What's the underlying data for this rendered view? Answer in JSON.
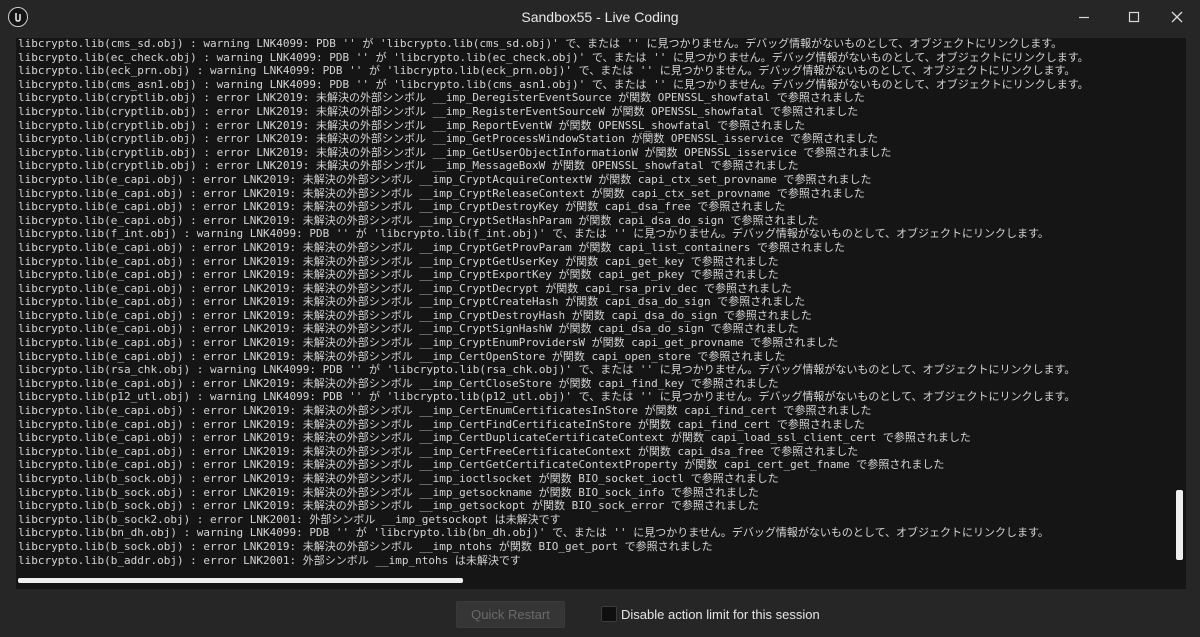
{
  "window": {
    "title": "Sandbox55 - Live Coding",
    "icon": "unreal-engine-logo",
    "controls": [
      "minimize-icon",
      "maximize-icon",
      "close-icon"
    ]
  },
  "log": {
    "lines": [
      "libcrypto.lib(cms_sd.obj) : warning LNK4099: PDB '' が 'libcrypto.lib(cms_sd.obj)' で、または '' に見つかりません。デバッグ情報がないものとして、オブジェクトにリンクします。",
      "libcrypto.lib(ec_check.obj) : warning LNK4099: PDB '' が 'libcrypto.lib(ec_check.obj)' で、または '' に見つかりません。デバッグ情報がないものとして、オブジェクトにリンクします。",
      "libcrypto.lib(eck_prn.obj) : warning LNK4099: PDB '' が 'libcrypto.lib(eck_prn.obj)' で、または '' に見つかりません。デバッグ情報がないものとして、オブジェクトにリンクします。",
      "libcrypto.lib(cms_asn1.obj) : warning LNK4099: PDB '' が 'libcrypto.lib(cms_asn1.obj)' で、または '' に見つかりません。デバッグ情報がないものとして、オブジェクトにリンクします。",
      "libcrypto.lib(cryptlib.obj) : error LNK2019: 未解決の外部シンボル __imp_DeregisterEventSource が関数 OPENSSL_showfatal で参照されました",
      "libcrypto.lib(cryptlib.obj) : error LNK2019: 未解決の外部シンボル __imp_RegisterEventSourceW が関数 OPENSSL_showfatal で参照されました",
      "libcrypto.lib(cryptlib.obj) : error LNK2019: 未解決の外部シンボル __imp_ReportEventW が関数 OPENSSL_showfatal で参照されました",
      "libcrypto.lib(cryptlib.obj) : error LNK2019: 未解決の外部シンボル __imp_GetProcessWindowStation が関数 OPENSSL_isservice で参照されました",
      "libcrypto.lib(cryptlib.obj) : error LNK2019: 未解決の外部シンボル __imp_GetUserObjectInformationW が関数 OPENSSL_isservice で参照されました",
      "libcrypto.lib(cryptlib.obj) : error LNK2019: 未解決の外部シンボル __imp_MessageBoxW が関数 OPENSSL_showfatal で参照されました",
      "libcrypto.lib(e_capi.obj) : error LNK2019: 未解決の外部シンボル __imp_CryptAcquireContextW が関数 capi_ctx_set_provname で参照されました",
      "libcrypto.lib(e_capi.obj) : error LNK2019: 未解決の外部シンボル __imp_CryptReleaseContext が関数 capi_ctx_set_provname で参照されました",
      "libcrypto.lib(e_capi.obj) : error LNK2019: 未解決の外部シンボル __imp_CryptDestroyKey が関数 capi_dsa_free で参照されました",
      "libcrypto.lib(e_capi.obj) : error LNK2019: 未解決の外部シンボル __imp_CryptSetHashParam が関数 capi_dsa_do_sign で参照されました",
      "libcrypto.lib(f_int.obj) : warning LNK4099: PDB '' が 'libcrypto.lib(f_int.obj)' で、または '' に見つかりません。デバッグ情報がないものとして、オブジェクトにリンクします。",
      "libcrypto.lib(e_capi.obj) : error LNK2019: 未解決の外部シンボル __imp_CryptGetProvParam が関数 capi_list_containers で参照されました",
      "libcrypto.lib(e_capi.obj) : error LNK2019: 未解決の外部シンボル __imp_CryptGetUserKey が関数 capi_get_key で参照されました",
      "libcrypto.lib(e_capi.obj) : error LNK2019: 未解決の外部シンボル __imp_CryptExportKey が関数 capi_get_pkey で参照されました",
      "libcrypto.lib(e_capi.obj) : error LNK2019: 未解決の外部シンボル __imp_CryptDecrypt が関数 capi_rsa_priv_dec で参照されました",
      "libcrypto.lib(e_capi.obj) : error LNK2019: 未解決の外部シンボル __imp_CryptCreateHash が関数 capi_dsa_do_sign で参照されました",
      "libcrypto.lib(e_capi.obj) : error LNK2019: 未解決の外部シンボル __imp_CryptDestroyHash が関数 capi_dsa_do_sign で参照されました",
      "libcrypto.lib(e_capi.obj) : error LNK2019: 未解決の外部シンボル __imp_CryptSignHashW が関数 capi_dsa_do_sign で参照されました",
      "libcrypto.lib(e_capi.obj) : error LNK2019: 未解決の外部シンボル __imp_CryptEnumProvidersW が関数 capi_get_provname で参照されました",
      "libcrypto.lib(e_capi.obj) : error LNK2019: 未解決の外部シンボル __imp_CertOpenStore が関数 capi_open_store で参照されました",
      "libcrypto.lib(rsa_chk.obj) : warning LNK4099: PDB '' が 'libcrypto.lib(rsa_chk.obj)' で、または '' に見つかりません。デバッグ情報がないものとして、オブジェクトにリンクします。",
      "libcrypto.lib(e_capi.obj) : error LNK2019: 未解決の外部シンボル __imp_CertCloseStore が関数 capi_find_key で参照されました",
      "libcrypto.lib(p12_utl.obj) : warning LNK4099: PDB '' が 'libcrypto.lib(p12_utl.obj)' で、または '' に見つかりません。デバッグ情報がないものとして、オブジェクトにリンクします。",
      "libcrypto.lib(e_capi.obj) : error LNK2019: 未解決の外部シンボル __imp_CertEnumCertificatesInStore が関数 capi_find_cert で参照されました",
      "libcrypto.lib(e_capi.obj) : error LNK2019: 未解決の外部シンボル __imp_CertFindCertificateInStore が関数 capi_find_cert で参照されました",
      "libcrypto.lib(e_capi.obj) : error LNK2019: 未解決の外部シンボル __imp_CertDuplicateCertificateContext が関数 capi_load_ssl_client_cert で参照されました",
      "libcrypto.lib(e_capi.obj) : error LNK2019: 未解決の外部シンボル __imp_CertFreeCertificateContext が関数 capi_dsa_free で参照されました",
      "libcrypto.lib(e_capi.obj) : error LNK2019: 未解決の外部シンボル __imp_CertGetCertificateContextProperty が関数 capi_cert_get_fname で参照されました",
      "libcrypto.lib(b_sock.obj) : error LNK2019: 未解決の外部シンボル __imp_ioctlsocket が関数 BIO_socket_ioctl で参照されました",
      "libcrypto.lib(b_sock.obj) : error LNK2019: 未解決の外部シンボル __imp_getsockname が関数 BIO_sock_info で参照されました",
      "libcrypto.lib(b_sock.obj) : error LNK2019: 未解決の外部シンボル __imp_getsockopt が関数 BIO_sock_error で参照されました",
      "libcrypto.lib(b_sock2.obj) : error LNK2001: 外部シンボル __imp_getsockopt は未解決です",
      "libcrypto.lib(bn_dh.obj) : warning LNK4099: PDB '' が 'libcrypto.lib(bn_dh.obj)' で、または '' に見つかりません。デバッグ情報がないものとして、オブジェクトにリンクします。",
      "libcrypto.lib(b_sock.obj) : error LNK2019: 未解決の外部シンボル __imp_ntohs が関数 BIO_get_port で参照されました",
      "libcrypto.lib(b_addr.obj) : error LNK2001: 外部シンボル __imp_ntohs は未解決です"
    ]
  },
  "footer": {
    "quick_restart_label": "Quick Restart",
    "disable_action_limit_label": "Disable action limit for this session",
    "disable_action_limit_checked": false
  }
}
